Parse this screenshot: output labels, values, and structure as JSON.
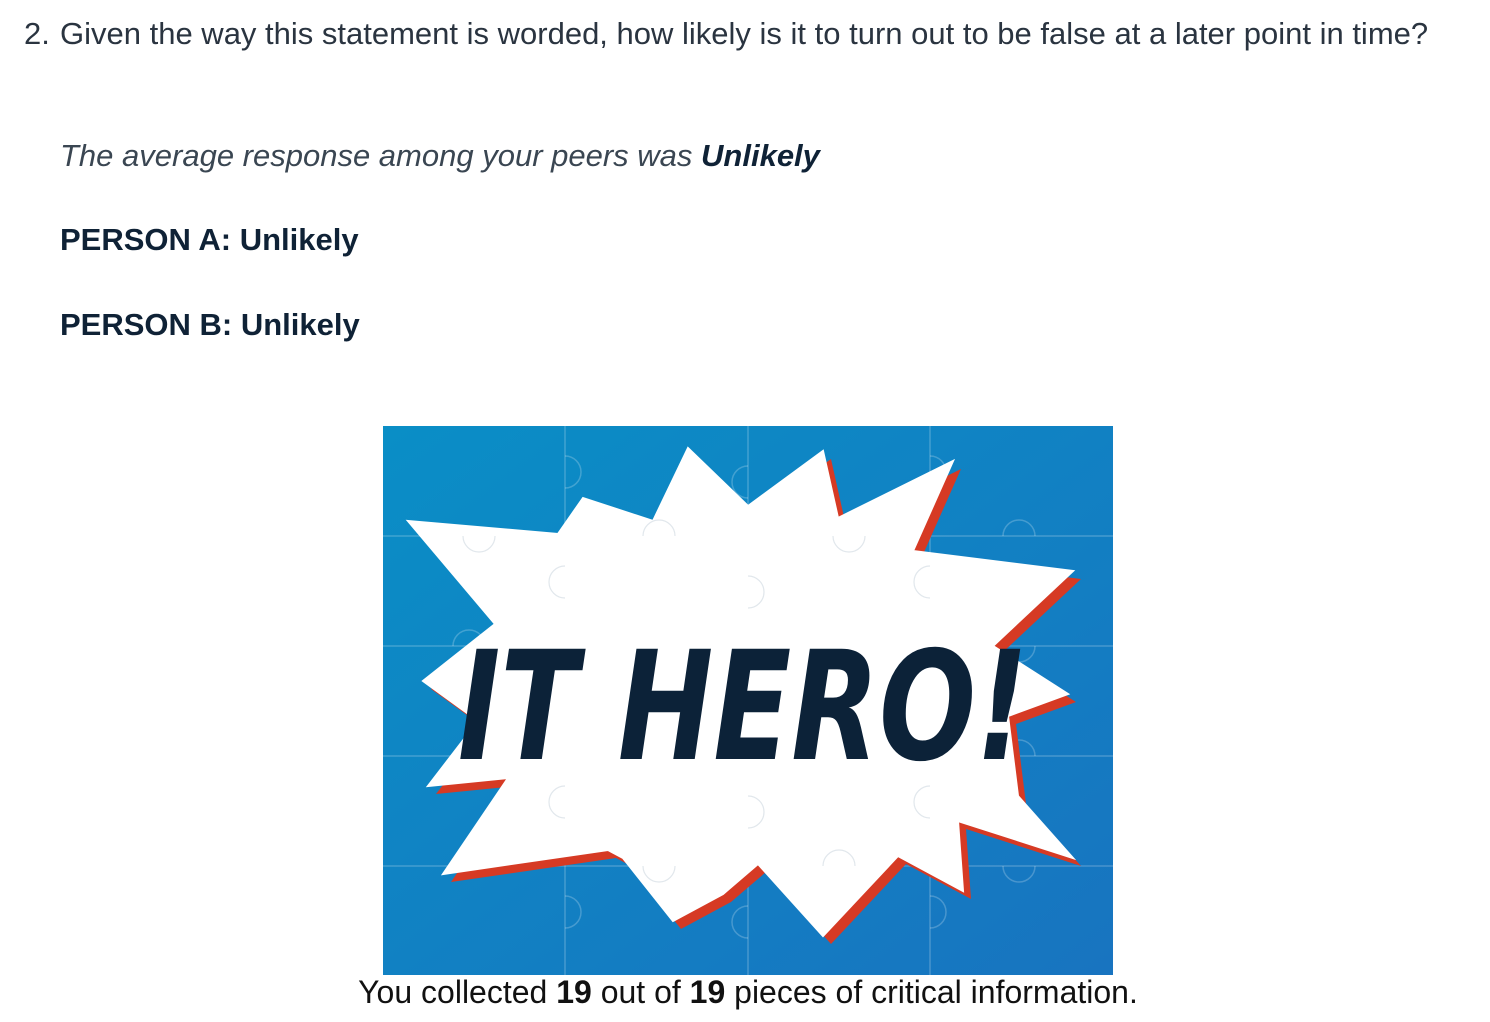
{
  "question": {
    "number": "2.",
    "text": "Given the way this statement is worded, how likely is it to turn out to be false at a later point in time?"
  },
  "peer_average": {
    "prefix": "The average response among your peers was ",
    "value": "Unlikely"
  },
  "responses": [
    {
      "label": "PERSON A: Unlikely"
    },
    {
      "label": "PERSON B: Unlikely"
    }
  ],
  "hero_image": {
    "text": "IT HERO!",
    "background_start": "#0a8ec6",
    "background_end": "#1874c0",
    "burst_color": "#ffffff",
    "shadow_color": "#d63a24",
    "text_color": "#0c2238"
  },
  "collected": {
    "prefix": "You collected ",
    "count": "19",
    "middle": " out of ",
    "total": "19",
    "suffix": " pieces of critical information."
  }
}
